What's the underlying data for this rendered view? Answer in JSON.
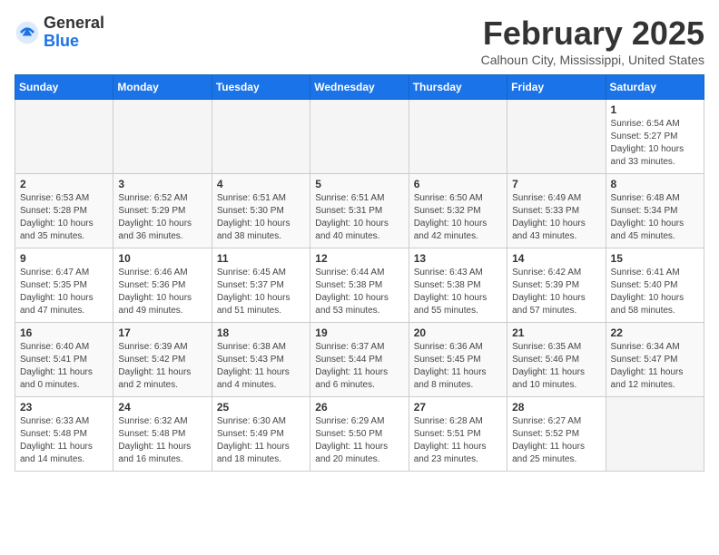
{
  "header": {
    "logo_general": "General",
    "logo_blue": "Blue",
    "month_title": "February 2025",
    "location": "Calhoun City, Mississippi, United States"
  },
  "days_of_week": [
    "Sunday",
    "Monday",
    "Tuesday",
    "Wednesday",
    "Thursday",
    "Friday",
    "Saturday"
  ],
  "weeks": [
    [
      {
        "day": "",
        "info": ""
      },
      {
        "day": "",
        "info": ""
      },
      {
        "day": "",
        "info": ""
      },
      {
        "day": "",
        "info": ""
      },
      {
        "day": "",
        "info": ""
      },
      {
        "day": "",
        "info": ""
      },
      {
        "day": "1",
        "info": "Sunrise: 6:54 AM\nSunset: 5:27 PM\nDaylight: 10 hours and 33 minutes."
      }
    ],
    [
      {
        "day": "2",
        "info": "Sunrise: 6:53 AM\nSunset: 5:28 PM\nDaylight: 10 hours and 35 minutes."
      },
      {
        "day": "3",
        "info": "Sunrise: 6:52 AM\nSunset: 5:29 PM\nDaylight: 10 hours and 36 minutes."
      },
      {
        "day": "4",
        "info": "Sunrise: 6:51 AM\nSunset: 5:30 PM\nDaylight: 10 hours and 38 minutes."
      },
      {
        "day": "5",
        "info": "Sunrise: 6:51 AM\nSunset: 5:31 PM\nDaylight: 10 hours and 40 minutes."
      },
      {
        "day": "6",
        "info": "Sunrise: 6:50 AM\nSunset: 5:32 PM\nDaylight: 10 hours and 42 minutes."
      },
      {
        "day": "7",
        "info": "Sunrise: 6:49 AM\nSunset: 5:33 PM\nDaylight: 10 hours and 43 minutes."
      },
      {
        "day": "8",
        "info": "Sunrise: 6:48 AM\nSunset: 5:34 PM\nDaylight: 10 hours and 45 minutes."
      }
    ],
    [
      {
        "day": "9",
        "info": "Sunrise: 6:47 AM\nSunset: 5:35 PM\nDaylight: 10 hours and 47 minutes."
      },
      {
        "day": "10",
        "info": "Sunrise: 6:46 AM\nSunset: 5:36 PM\nDaylight: 10 hours and 49 minutes."
      },
      {
        "day": "11",
        "info": "Sunrise: 6:45 AM\nSunset: 5:37 PM\nDaylight: 10 hours and 51 minutes."
      },
      {
        "day": "12",
        "info": "Sunrise: 6:44 AM\nSunset: 5:38 PM\nDaylight: 10 hours and 53 minutes."
      },
      {
        "day": "13",
        "info": "Sunrise: 6:43 AM\nSunset: 5:38 PM\nDaylight: 10 hours and 55 minutes."
      },
      {
        "day": "14",
        "info": "Sunrise: 6:42 AM\nSunset: 5:39 PM\nDaylight: 10 hours and 57 minutes."
      },
      {
        "day": "15",
        "info": "Sunrise: 6:41 AM\nSunset: 5:40 PM\nDaylight: 10 hours and 58 minutes."
      }
    ],
    [
      {
        "day": "16",
        "info": "Sunrise: 6:40 AM\nSunset: 5:41 PM\nDaylight: 11 hours and 0 minutes."
      },
      {
        "day": "17",
        "info": "Sunrise: 6:39 AM\nSunset: 5:42 PM\nDaylight: 11 hours and 2 minutes."
      },
      {
        "day": "18",
        "info": "Sunrise: 6:38 AM\nSunset: 5:43 PM\nDaylight: 11 hours and 4 minutes."
      },
      {
        "day": "19",
        "info": "Sunrise: 6:37 AM\nSunset: 5:44 PM\nDaylight: 11 hours and 6 minutes."
      },
      {
        "day": "20",
        "info": "Sunrise: 6:36 AM\nSunset: 5:45 PM\nDaylight: 11 hours and 8 minutes."
      },
      {
        "day": "21",
        "info": "Sunrise: 6:35 AM\nSunset: 5:46 PM\nDaylight: 11 hours and 10 minutes."
      },
      {
        "day": "22",
        "info": "Sunrise: 6:34 AM\nSunset: 5:47 PM\nDaylight: 11 hours and 12 minutes."
      }
    ],
    [
      {
        "day": "23",
        "info": "Sunrise: 6:33 AM\nSunset: 5:48 PM\nDaylight: 11 hours and 14 minutes."
      },
      {
        "day": "24",
        "info": "Sunrise: 6:32 AM\nSunset: 5:48 PM\nDaylight: 11 hours and 16 minutes."
      },
      {
        "day": "25",
        "info": "Sunrise: 6:30 AM\nSunset: 5:49 PM\nDaylight: 11 hours and 18 minutes."
      },
      {
        "day": "26",
        "info": "Sunrise: 6:29 AM\nSunset: 5:50 PM\nDaylight: 11 hours and 20 minutes."
      },
      {
        "day": "27",
        "info": "Sunrise: 6:28 AM\nSunset: 5:51 PM\nDaylight: 11 hours and 23 minutes."
      },
      {
        "day": "28",
        "info": "Sunrise: 6:27 AM\nSunset: 5:52 PM\nDaylight: 11 hours and 25 minutes."
      },
      {
        "day": "",
        "info": ""
      }
    ]
  ]
}
